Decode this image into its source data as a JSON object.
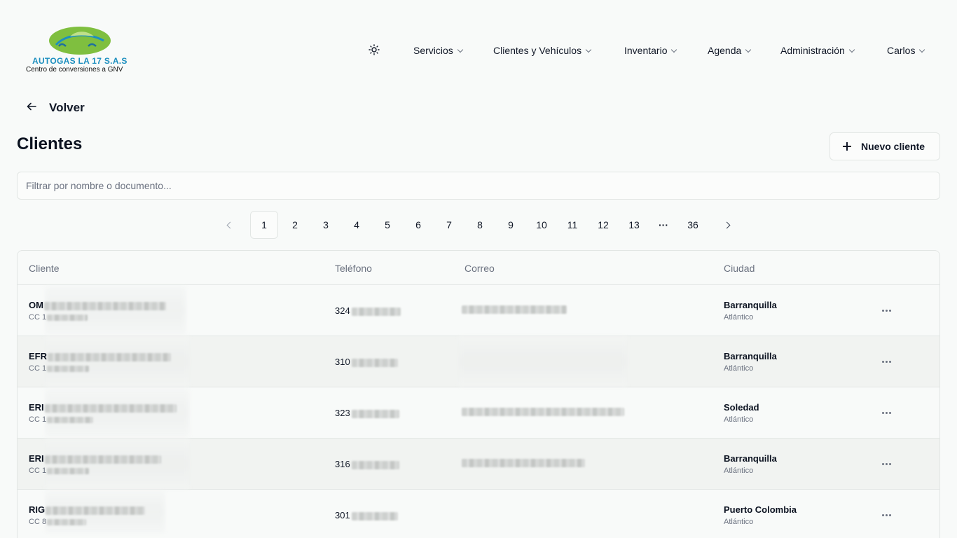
{
  "logo": {
    "name": "AUTOGAS LA 17 S.A.S",
    "subtitle": "Centro de conversiones a GNV"
  },
  "nav": {
    "theme_icon": "sun-icon",
    "items": [
      {
        "label": "Servicios"
      },
      {
        "label": "Clientes y Vehículos"
      },
      {
        "label": "Inventario"
      },
      {
        "label": "Agenda"
      },
      {
        "label": "Administración"
      },
      {
        "label": "Carlos"
      }
    ]
  },
  "back": {
    "label": "Volver",
    "icon": "arrow-left-icon"
  },
  "page": {
    "title": "Clientes"
  },
  "new_client": {
    "label": "Nuevo cliente",
    "icon": "plus-icon"
  },
  "filter": {
    "placeholder": "Filtrar por nombre o documento...",
    "value": ""
  },
  "pagination": {
    "current": "1",
    "pages": [
      "1",
      "2",
      "3",
      "4",
      "5",
      "6",
      "7",
      "8",
      "9",
      "10",
      "11",
      "12",
      "13"
    ],
    "ellipsis": "···",
    "last": "36"
  },
  "table": {
    "columns": {
      "client": "Cliente",
      "phone": "Teléfono",
      "email": "Correo",
      "city": "Ciudad"
    },
    "rows": [
      {
        "name": "OM",
        "doc": "CC 1",
        "phone": "324",
        "has_email": true,
        "city": "Barranquilla",
        "dept": "Atlántico"
      },
      {
        "name": "EFR",
        "doc": "CC 1",
        "phone": "310",
        "has_email": false,
        "city": "Barranquilla",
        "dept": "Atlántico"
      },
      {
        "name": "ERI",
        "doc": "CC 1",
        "phone": "323",
        "has_email": true,
        "city": "Soledad",
        "dept": "Atlántico"
      },
      {
        "name": "ERI",
        "doc": "CC 1",
        "phone": "316",
        "has_email": true,
        "city": "Barranquilla",
        "dept": "Atlántico"
      },
      {
        "name": "RIG",
        "doc": "CC 8",
        "phone": "301",
        "has_email": false,
        "city": "Puerto Colombia",
        "dept": "Atlántico"
      }
    ]
  },
  "colors": {
    "background": "#f8faf9",
    "border": "#e2e6e4",
    "logo_green": "#7fbf3f",
    "logo_blue": "#1d8fbf"
  }
}
